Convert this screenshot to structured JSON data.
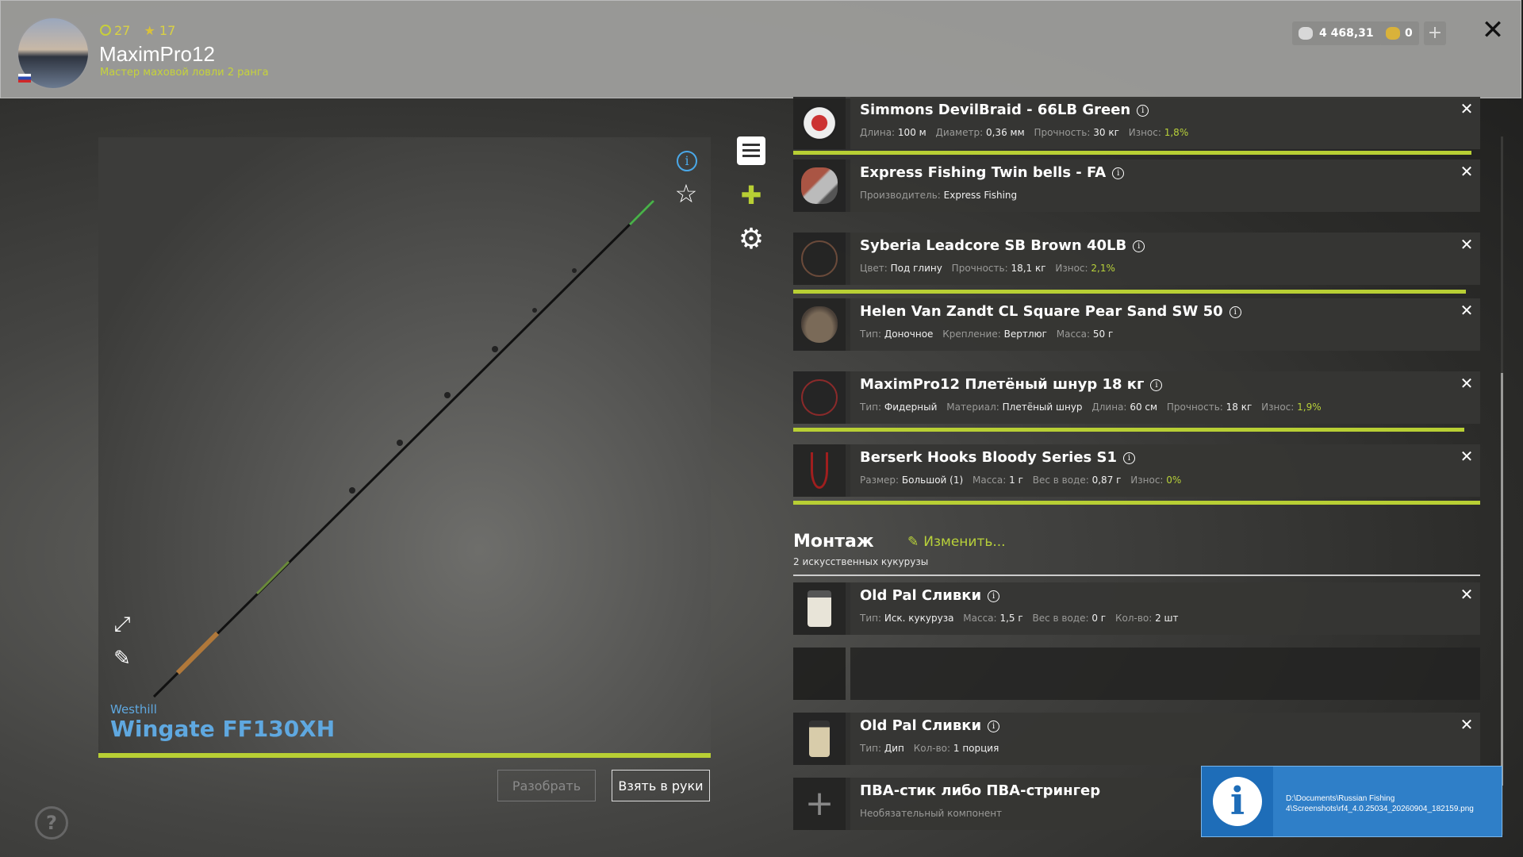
{
  "player": {
    "level": "27",
    "stars": "17",
    "username": "MaximPro12",
    "rank": "Мастер маховой ловли 2 ранга"
  },
  "currency": {
    "silver": "4 468,31",
    "gold": "0",
    "add_label": "+"
  },
  "rod": {
    "brand": "Westhill",
    "name": "Wingate FF130XH",
    "disassemble_label": "Разобрать",
    "take_label": "Взять в руки"
  },
  "tackle": [
    {
      "name": "Simmons DevilBraid - 66LB Green",
      "props": [
        [
          "Длина:",
          "100 м"
        ],
        [
          "Диаметр:",
          "0,36 мм"
        ],
        [
          "Прочность:",
          "30 кг"
        ]
      ],
      "wear_label": "Износ:",
      "wear": "1,8%"
    },
    {
      "name": "Express Fishing Twin bells - FA",
      "props": [
        [
          "Производитель:",
          "Express Fishing"
        ]
      ]
    },
    {
      "name": "Syberia Leadcore SB Brown 40LB",
      "props": [
        [
          "Цвет:",
          "Под глину"
        ],
        [
          "Прочность:",
          "18,1 кг"
        ]
      ],
      "wear_label": "Износ:",
      "wear": "2,1%"
    },
    {
      "name": "Helen Van Zandt CL Square Pear Sand SW 50",
      "props": [
        [
          "Тип:",
          "Доночное"
        ],
        [
          "Крепление:",
          "Вертлюг"
        ],
        [
          "Масса:",
          "50 г"
        ]
      ]
    },
    {
      "name": "MaximPro12 Плетёный шнур 18 кг",
      "props": [
        [
          "Тип:",
          "Фидерный"
        ],
        [
          "Материал:",
          "Плетёный шнур"
        ],
        [
          "Длина:",
          "60 см"
        ],
        [
          "Прочность:",
          "18 кг"
        ]
      ],
      "wear_label": "Износ:",
      "wear": "1,9%"
    },
    {
      "name": "Berserk Hooks Bloody Series S1",
      "props": [
        [
          "Размер:",
          "Большой (1)"
        ],
        [
          "Масса:",
          "1 г"
        ],
        [
          "Вес в воде:",
          "0,87 г"
        ]
      ],
      "wear_label": "Износ:",
      "wear": "0%"
    }
  ],
  "montage": {
    "title": "Монтаж",
    "edit_label": "Изменить...",
    "subtitle": "2 искусственных кукурузы",
    "items": [
      {
        "name": "Old Pal Сливки",
        "props": [
          [
            "Тип:",
            "Иск. кукуруза"
          ],
          [
            "Масса:",
            "1,5 г"
          ],
          [
            "Вес в воде:",
            "0 г"
          ],
          [
            "Кол-во:",
            "2 шт"
          ]
        ]
      },
      {
        "name": "Old Pal Сливки",
        "props": [
          [
            "Тип:",
            "Дип"
          ],
          [
            "Кол-во:",
            "1 порция"
          ]
        ]
      }
    ],
    "pva": {
      "name": "ПВА-стик либо ПВА-стрингер",
      "note": "Необязательный компонент"
    }
  },
  "toast": {
    "path": "D:\\Documents\\Russian Fishing 4\\Screenshots\\rf4_4.0.25034_20260904_182159.png"
  },
  "colors": {
    "accent": "#b8cf34",
    "link_blue": "#5fa8e0",
    "toast_blue": "#2f7fc8"
  },
  "icons": [
    "info-icon",
    "star-icon",
    "expand-icon",
    "edit-icon",
    "doc-icon",
    "puzzle-icon",
    "gear-icon",
    "close-icon",
    "help-icon"
  ]
}
